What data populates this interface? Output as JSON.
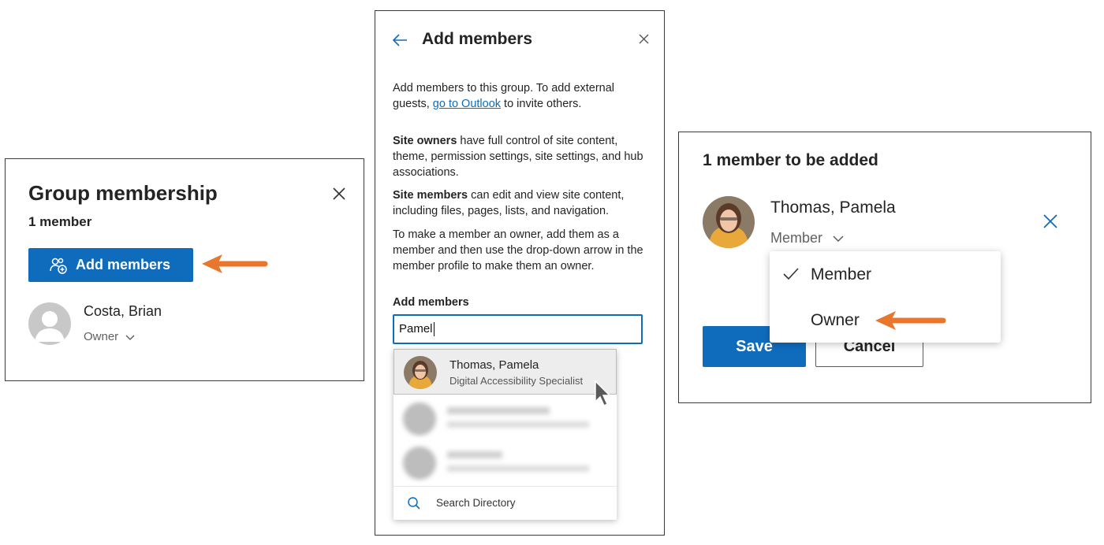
{
  "group_panel": {
    "title": "Group membership",
    "member_count": "1 member",
    "add_button": "Add members",
    "member": {
      "name": "Costa, Brian",
      "role": "Owner"
    }
  },
  "add_panel": {
    "title": "Add members",
    "intro_before_link": "Add members to this group. To add external guests, ",
    "intro_link": "go to Outlook",
    "intro_after_link": " to invite others.",
    "owners_term": "Site owners",
    "owners_desc": " have full control of site content, theme, permission settings, site settings, and hub associations.",
    "members_term": "Site members",
    "members_desc": " can edit and view site content, including files, pages, lists, and navigation.",
    "owner_howto": "To make a member an owner, add them as a member and then use the drop-down arrow in the member profile to make them an owner.",
    "field_label": "Add members",
    "field_value": "Pamel",
    "suggestion": {
      "name": "Thomas, Pamela",
      "title": "Digital Accessibility Specialist"
    },
    "search_directory": "Search Directory"
  },
  "confirm_panel": {
    "title": "1 member to be added",
    "member": {
      "name": "Thomas, Pamela",
      "role": "Member"
    },
    "role_options": [
      "Member",
      "Owner"
    ],
    "selected_role": "Member",
    "save_button": "Save",
    "cancel_button": "Cancel"
  },
  "colors": {
    "primary": "#0f6cbd",
    "callout_arrow": "#e8762d"
  }
}
